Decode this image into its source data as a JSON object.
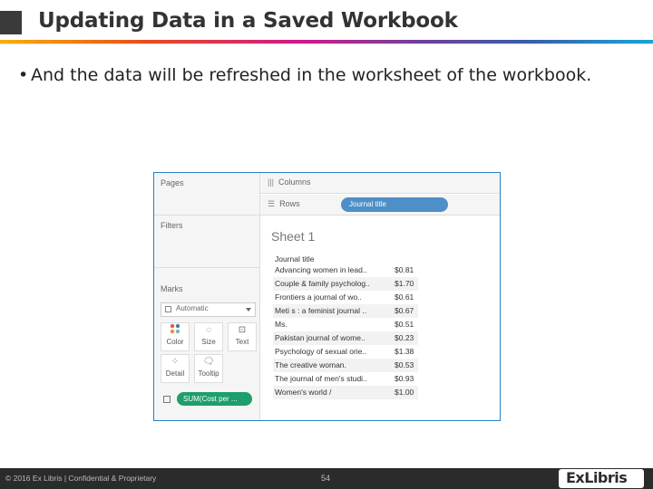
{
  "slide": {
    "title": "Updating Data in a Saved Workbook",
    "bullet": "And the data will be refreshed in the worksheet of the workbook."
  },
  "tableau": {
    "left": {
      "pages_label": "Pages",
      "filters_label": "Filters",
      "marks_label": "Marks",
      "mark_type": "Automatic",
      "buttons": [
        "Color",
        "Size",
        "Text",
        "Detail",
        "Tooltip"
      ],
      "sum_pill": "SUM(Cost per ..."
    },
    "shelves": {
      "columns_label": "Columns",
      "rows_label": "Rows",
      "rows_pill": "Journal title"
    },
    "sheet": {
      "title": "Sheet 1",
      "column_header": "Journal title",
      "rows": [
        {
          "title": "Advancing women in lead..",
          "value": "$0.81"
        },
        {
          "title": "Couple & family psycholog..",
          "value": "$1.70"
        },
        {
          "title": "Frontiers a journal of wo..",
          "value": "$0.61"
        },
        {
          "title": "Meti s : a feminist journal ..",
          "value": "$0.67"
        },
        {
          "title": "Ms.",
          "value": "$0.51"
        },
        {
          "title": "Pakistan journal of wome..",
          "value": "$0.23"
        },
        {
          "title": "Psychology of sexual orie..",
          "value": "$1.38"
        },
        {
          "title": "The creative woman.",
          "value": "$0.53"
        },
        {
          "title": "The journal of men's studi..",
          "value": "$0.93"
        },
        {
          "title": "Women's world /",
          "value": "$1.00"
        }
      ]
    }
  },
  "footer": {
    "copyright": "© 2016 Ex Libris | Confidential & Proprietary",
    "page_number": "54",
    "logo": "ExLibris"
  }
}
